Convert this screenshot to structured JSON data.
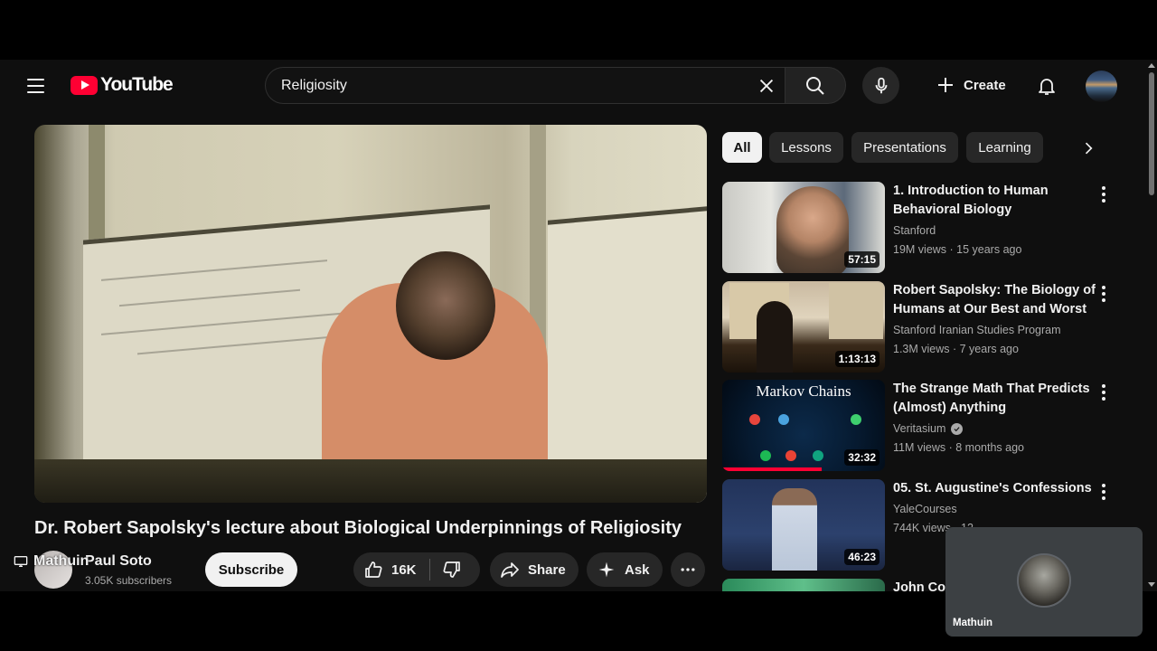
{
  "masthead": {
    "logo_text": "YouTube",
    "search_value": "Religiosity",
    "create_label": "Create",
    "icons": [
      "menu-icon",
      "youtube-logo-icon",
      "clear-icon",
      "search-icon",
      "mic-icon",
      "plus-icon",
      "bell-icon",
      "account-avatar"
    ]
  },
  "video": {
    "title": "Dr. Robert Sapolsky's lecture about Biological Underpinnings of Religiosity",
    "channel": "Paul Soto",
    "subscribers": "3.05K subscribers",
    "subscribe_label": "Subscribe",
    "like_count": "16K",
    "share_label": "Share",
    "ask_label": "Ask"
  },
  "chips": [
    "All",
    "Lessons",
    "Presentations",
    "Learning"
  ],
  "recommendations": [
    {
      "title": "1. Introduction to Human Behavioral Biology",
      "channel": "Stanford",
      "meta": "19M views · 15 years ago",
      "duration": "57:15",
      "verified": false
    },
    {
      "title": "Robert Sapolsky: The Biology of Humans at Our Best and Worst",
      "channel": "Stanford Iranian Studies Program",
      "meta": "1.3M views · 7 years ago",
      "duration": "1:13:13",
      "verified": false
    },
    {
      "title": "The Strange Math That Predicts (Almost) Anything",
      "channel": "Veritasium",
      "meta": "11M views · 8 months ago",
      "duration": "32:32",
      "verified": true,
      "thumb_text": "Markov Chains",
      "watched_fraction": 0.6
    },
    {
      "title": "05. St. Augustine's Confessions",
      "channel": "YaleCourses",
      "meta": "744K views · 12",
      "duration": "46:23",
      "verified": false
    },
    {
      "title": "John Cor",
      "channel": "",
      "meta": "",
      "duration": "",
      "verified": false
    }
  ],
  "overlay": {
    "camera_label": "Mathuin",
    "call_participant": "Mathuin"
  },
  "colors": {
    "background": "#0f0f0f",
    "brand_red": "#ff0033",
    "chip_bg": "#272727",
    "text_primary": "#f1f1f1",
    "text_secondary": "#aaaaaa"
  }
}
